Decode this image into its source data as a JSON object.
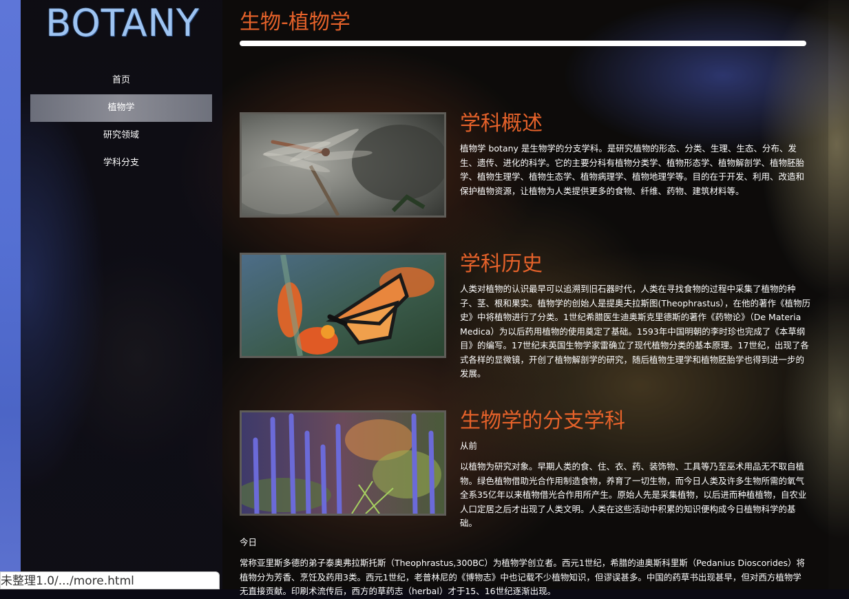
{
  "brand": {
    "logo_text": "BOTANY"
  },
  "nav": {
    "items": [
      {
        "label": "首页"
      },
      {
        "label": "植物学"
      },
      {
        "label": "研究领域"
      },
      {
        "label": "学科分支"
      }
    ],
    "active_index": 1
  },
  "page": {
    "title": "生物-植物学"
  },
  "sections": [
    {
      "title": "学科概述",
      "image_icon": "dragonfly-image",
      "text": "植物学 botany 是生物学的分支学科。是研究植物的形态、分类、生理、生态、分布、发生、遗传、进化的科学。它的主要分科有植物分类学、植物形态学、植物解剖学、植物胚胎学、植物生理学、植物生态学、植物病理学、植物地理学等。目的在于开发、利用、改造和保护植物资源，让植物为人类提供更多的食物、纤维、药物、建筑材料等。"
    },
    {
      "title": "学科历史",
      "image_icon": "butterfly-image",
      "text": "人类对植物的认识最早可以追溯到旧石器时代，人类在寻找食物的过程中采集了植物的种子、茎、根和果实。植物学的创始人是提奥夫拉斯图(Theophrastus），在他的著作《植物历史》中将植物进行了分类。1世纪希腊医生迪奥斯克里德斯的著作《药物论》（De Materia Medica）为以后药用植物的使用奠定了基础。1593年中国明朝的李时珍也完成了《本草纲目》的编写。17世纪末英国生物学家雷确立了现代植物分类的基本原理。17世纪，出现了各式各样的显微镜，开创了植物解剖学的研究，随后植物生理学和植物胚胎学也得到进一步的发展。"
    },
    {
      "title": "生物学的分支学科",
      "image_icon": "lavender-image",
      "subheading": "从前",
      "text": "以植物为研究对象。早期人类的食、住、衣、药、装饰物、工具等乃至巫术用品无不取自植物。绿色植物借助光合作用制造食物，养育了一切生物，而今日人类及许多生物所需的氧气全系35亿年以来植物借光合作用所产生。原始人先是采集植物，以后进而种植植物，自农业人口定居之后才出现了人类文明。人类在这些活动中积累的知识便构成今日植物科学的基础。"
    }
  ],
  "today": {
    "heading": "今日",
    "text": "常称亚里斯多德的弟子泰奥弗拉斯托斯（Theophrastus,300BC）为植物学创立者。西元1世纪，希腊的迪奥斯科里斯（Pedanius Dioscorides）将植物分为芳香、烹饪及药用3类。西元1世纪，老普林尼的《博物志》中也记载不少植物知识，但谬误甚多。中国的药草书出现甚早，但对西方植物学无直接贡献。印刷术流传后，西方的草药志（herbal）才于15、16世纪逐渐出现。"
  },
  "status_bar": {
    "url_text": "未整理1.0/.../more.html"
  }
}
